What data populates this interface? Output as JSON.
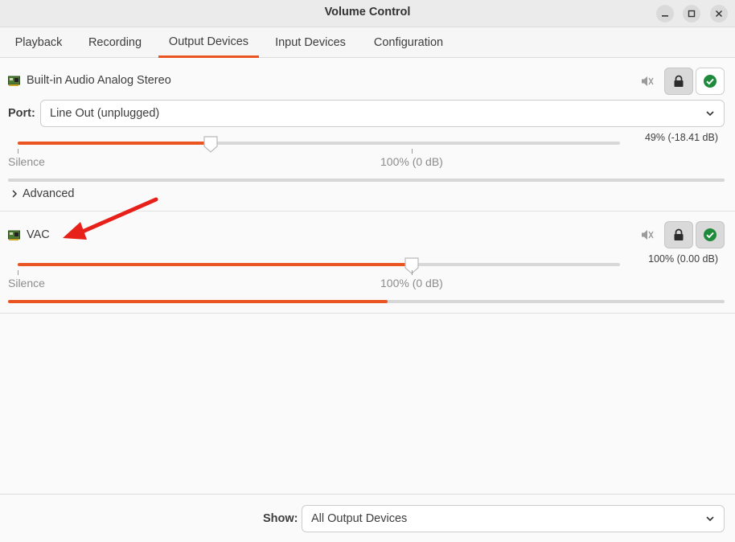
{
  "window": {
    "title": "Volume Control"
  },
  "tabs": [
    {
      "label": "Playback",
      "active": false
    },
    {
      "label": "Recording",
      "active": false
    },
    {
      "label": "Output Devices",
      "active": true
    },
    {
      "label": "Input Devices",
      "active": false
    },
    {
      "label": "Configuration",
      "active": false
    }
  ],
  "devices": [
    {
      "name": "Built-in Audio Analog Stereo",
      "port_label": "Port:",
      "port_value": "Line Out (unplugged)",
      "volume_text": "49% (-18.41 dB)",
      "volume_fraction": 0.49,
      "silence_label": "Silence",
      "hundred_label": "100% (0 dB)",
      "meter_fraction": 0.0,
      "advanced_label": "Advanced",
      "locked": true,
      "is_default": true
    },
    {
      "name": "VAC",
      "volume_text": "100% (0.00 dB)",
      "volume_fraction": 1.0,
      "silence_label": "Silence",
      "hundred_label": "100% (0 dB)",
      "meter_fraction": 0.53,
      "locked": true,
      "is_default": true
    }
  ],
  "footer": {
    "show_label": "Show:",
    "show_value": "All Output Devices"
  },
  "annotation": {
    "type": "red-arrow",
    "points_to": "VAC"
  },
  "colors": {
    "accent": "#e95420",
    "default_check": "#1e8a3c",
    "arrow": "#e8201a"
  },
  "icons": [
    "minimize-icon",
    "maximize-icon",
    "close-icon",
    "sound-card-icon",
    "muted-speaker-icon",
    "lock-icon",
    "check-circle-icon",
    "chevron-down-icon",
    "chevron-right-icon"
  ]
}
